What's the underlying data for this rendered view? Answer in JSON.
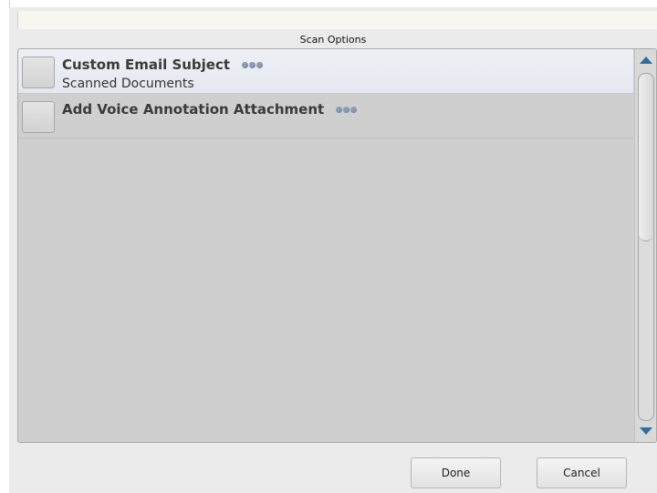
{
  "dialog": {
    "title": "Scan Options"
  },
  "options": [
    {
      "label": "Custom Email Subject",
      "value": "Scanned Documents",
      "selected": true,
      "more_icon": "more-dots-icon"
    },
    {
      "label": "Add Voice Annotation Attachment",
      "value": "",
      "selected": false,
      "more_icon": "more-dots-icon"
    }
  ],
  "buttons": {
    "done": "Done",
    "cancel": "Cancel"
  },
  "colors": {
    "accent": "#2d6da3",
    "dots": "#8c9cb6",
    "list_bg": "#cfcfcf",
    "selected_row": "#eceef4"
  },
  "scrollbar": {
    "up_icon": "triangle-up-icon",
    "down_icon": "triangle-down-icon"
  }
}
